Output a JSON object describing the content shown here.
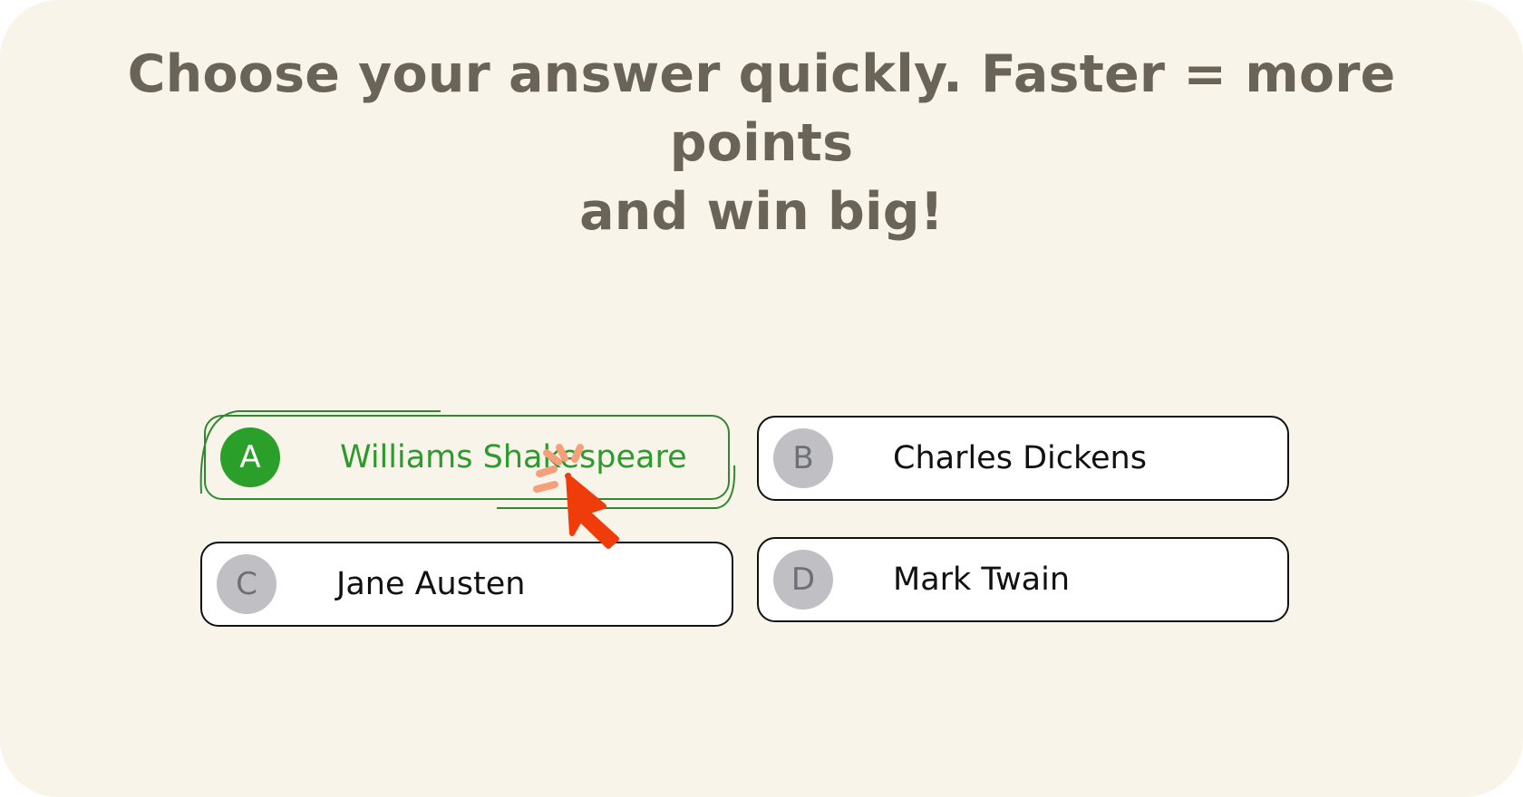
{
  "prompt": {
    "line1": "Choose your answer quickly. Faster = more points",
    "line2": "and win big!"
  },
  "options": [
    {
      "letter": "A",
      "label": "Williams Shakespeare",
      "state": "selected"
    },
    {
      "letter": "B",
      "label": "Charles Dickens",
      "state": "default"
    },
    {
      "letter": "C",
      "label": "Jane Austen",
      "state": "default"
    },
    {
      "letter": "D",
      "label": "Mark Twain",
      "state": "default"
    }
  ],
  "colors": {
    "background": "#f8f4ea",
    "prompt_text": "#6a6358",
    "selected_accent": "#2aa02a",
    "badge_inactive": "#bfbfc4",
    "cursor": "#f03c0a",
    "click_burst": "#f5a07a"
  },
  "icons": {
    "cursor": "pointer-cursor-icon",
    "click": "click-burst-icon"
  }
}
